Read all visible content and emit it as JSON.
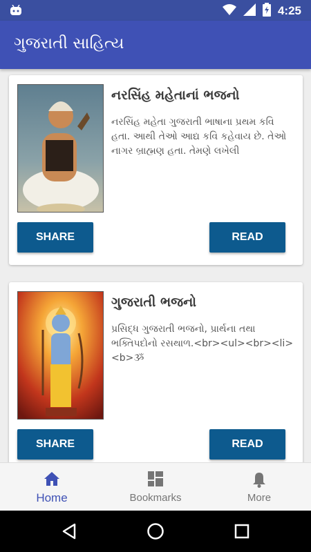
{
  "status_bar": {
    "time": "4:25",
    "icons": [
      "android-icon",
      "wifi-icon",
      "signal-icon",
      "battery-charging-icon"
    ]
  },
  "app_bar": {
    "title": "ગુજરાતી સાહિત્ય"
  },
  "cards": [
    {
      "title": "નરસિંહ મહેતાનાં ભજનો",
      "description": "નરસિંહ મહેતા ગુજરાતી ભાષાના પ્રથમ કવિ હતા. આથી તેઓ આદ્ય કવિ કહેવાય છે. તેઓ નાગર બ્રાહ્મણ હતા. તેમણે લખેલી",
      "share_label": "SHARE",
      "read_label": "READ"
    },
    {
      "title": "ગુજરાતી ભજનો",
      "description": "પ્રસિદ્ધ ગુજરાતી ભજનો, પ્રાર્થના તથા ભક્તિપદોનો રસથાળ.<br><ul><br><li><b>ૐ",
      "share_label": "SHARE",
      "read_label": "READ"
    }
  ],
  "bottom_nav": {
    "items": [
      {
        "label": "Home",
        "icon": "home-icon",
        "active": true
      },
      {
        "label": "Bookmarks",
        "icon": "dashboard-icon",
        "active": false
      },
      {
        "label": "More",
        "icon": "bell-icon",
        "active": false
      }
    ]
  },
  "colors": {
    "status_bar": "#3a4fa0",
    "app_bar": "#3f51b5",
    "button": "#0d5a8e",
    "nav_active": "#3f51b5",
    "nav_inactive": "#757575"
  }
}
